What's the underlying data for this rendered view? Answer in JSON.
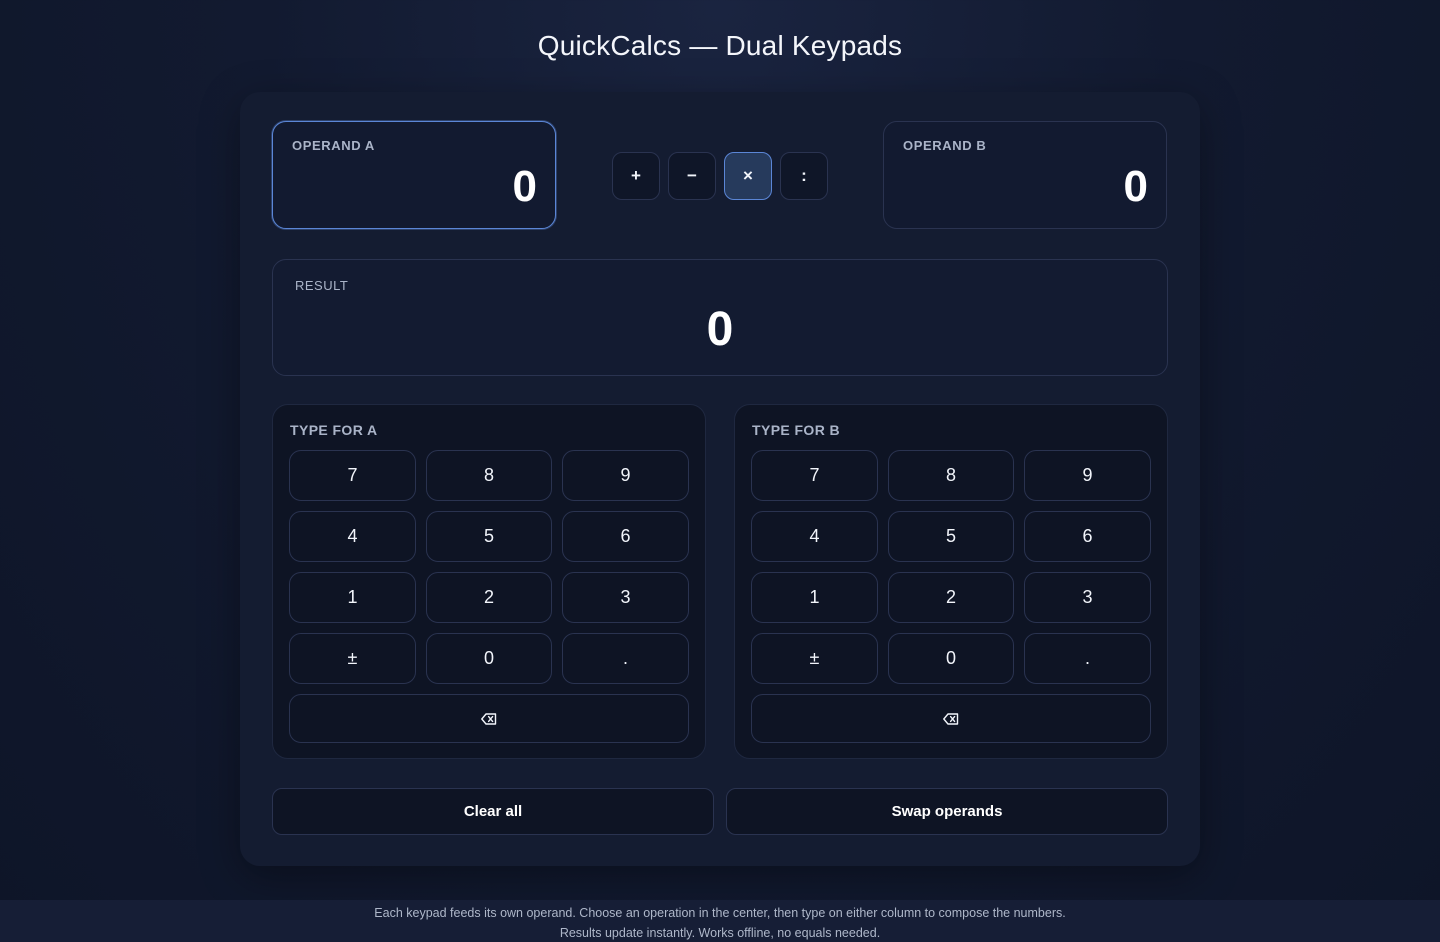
{
  "app": {
    "title": "QuickCalcs — Dual Keypads"
  },
  "operand_a": {
    "label": "OPERAND A",
    "value": "0"
  },
  "operand_b": {
    "label": "OPERAND B",
    "value": "0"
  },
  "operations": [
    {
      "symbol": "+",
      "name": "add"
    },
    {
      "symbol": "−",
      "name": "subtract"
    },
    {
      "symbol": "×",
      "name": "multiply",
      "selected": true
    },
    {
      "symbol": ":",
      "name": "divide"
    }
  ],
  "result": {
    "label": "RESULT",
    "value": "0"
  },
  "keypad_a": {
    "label": "TYPE FOR A",
    "keys": [
      "7",
      "8",
      "9",
      "4",
      "5",
      "6",
      "1",
      "2",
      "3",
      "±",
      "0",
      "."
    ],
    "backspace_icon": "backspace-icon"
  },
  "keypad_b": {
    "label": "TYPE FOR B",
    "keys": [
      "7",
      "8",
      "9",
      "4",
      "5",
      "6",
      "1",
      "2",
      "3",
      "±",
      "0",
      "."
    ],
    "backspace_icon": "backspace-icon"
  },
  "actions": {
    "clear_label": "Clear all",
    "swap_label": "Swap operands"
  },
  "footer": {
    "line1": "Each keypad feeds its own operand. Choose an operation in the center, then type on either column to compose the numbers.",
    "line2": "Results update instantly. Works offline, no equals needed."
  },
  "colors": {
    "accent": "#5b86d6",
    "panel": "#141c31",
    "background": "#0e1528"
  }
}
